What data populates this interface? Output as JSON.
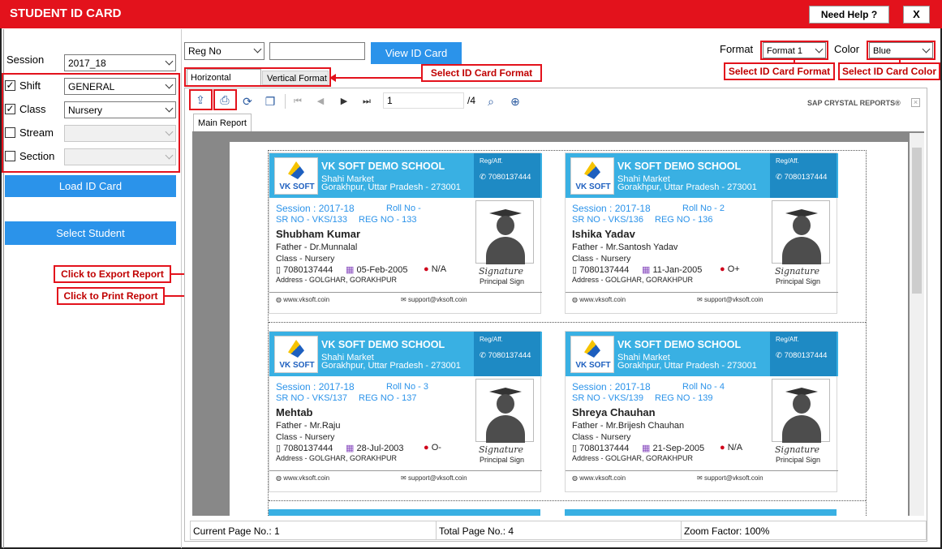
{
  "window": {
    "title": "STUDENT ID CARD",
    "help_label": "Need Help ?",
    "close_label": "X"
  },
  "left": {
    "session_label": "Session",
    "session_value": "2017_18",
    "shift_label": "Shift",
    "shift_value": "GENERAL",
    "shift_checked": "✓",
    "class_label": "Class",
    "class_value": "Nursery",
    "class_checked": "✓",
    "stream_label": "Stream",
    "section_label": "Section",
    "load_btn": "Load ID Card",
    "select_btn": "Select Student"
  },
  "search": {
    "field": "Reg No",
    "view_btn": "View ID Card"
  },
  "format": {
    "format_label": "Format",
    "format_value": "Format 1",
    "color_label": "Color",
    "color_value": "Blue"
  },
  "tabs": [
    "Horizontal Format",
    "Vertical Format"
  ],
  "callouts": {
    "format": "Select ID Card Format",
    "card_format": "Select ID Card Format",
    "card_color": "Select ID Card Color",
    "export": "Click to Export Report",
    "print": "Click to Print Report"
  },
  "toolbar": {
    "page": "1",
    "total": "/4",
    "brand": "SAP CRYSTAL REPORTS®"
  },
  "report_tab": "Main Report",
  "school": {
    "name": "VK SOFT DEMO SCHOOL",
    "addr1": "Shahi Market",
    "addr2": "Gorakhpur, Uttar Pradesh - 273001",
    "reg": "Reg/Aff.",
    "phone": "7080137444",
    "logo_text": "VK SOFT",
    "web": "www.vksoft.coin",
    "mail": "support@vksoft.coin",
    "principal": "Principal Sign",
    "signature": "Signature"
  },
  "cards": [
    {
      "session": "Session : 2017-18",
      "roll": "Roll No -",
      "srno": "SR NO - VKS/133",
      "regno": "REG NO - 133",
      "name": "Shubham Kumar",
      "father": "Father - Dr.Munnalal",
      "cls": "Class - Nursery",
      "mobile": "7080137444",
      "dob": "05-Feb-2005",
      "blood": "N/A",
      "address": "Address - GOLGHAR, GORAKHPUR"
    },
    {
      "session": "Session : 2017-18",
      "roll": "Roll No - 2",
      "srno": "SR NO - VKS/136",
      "regno": "REG NO - 136",
      "name": "Ishika Yadav",
      "father": "Father - Mr.Santosh Yadav",
      "cls": "Class - Nursery",
      "mobile": "7080137444",
      "dob": "11-Jan-2005",
      "blood": "O+",
      "address": "Address - GOLGHAR, GORAKHPUR"
    },
    {
      "session": "Session : 2017-18",
      "roll": "Roll No - 3",
      "srno": "SR NO - VKS/137",
      "regno": "REG NO - 137",
      "name": "Mehtab",
      "father": "Father - Mr.Raju",
      "cls": "Class - Nursery",
      "mobile": "7080137444",
      "dob": "28-Jul-2003",
      "blood": "O-",
      "address": "Address - GOLGHAR, GORAKHPUR"
    },
    {
      "session": "Session : 2017-18",
      "roll": "Roll No - 4",
      "srno": "SR NO - VKS/139",
      "regno": "REG NO - 139",
      "name": "Shreya Chauhan",
      "father": "Father - Mr.Brijesh Chauhan",
      "cls": "Class - Nursery",
      "mobile": "7080137444",
      "dob": "21-Sep-2005",
      "blood": "N/A",
      "address": "Address - GOLGHAR, GORAKHPUR"
    }
  ],
  "status": {
    "current": "Current Page No.: 1",
    "total": "Total Page No.: 4",
    "zoom": "Zoom Factor: 100%"
  }
}
